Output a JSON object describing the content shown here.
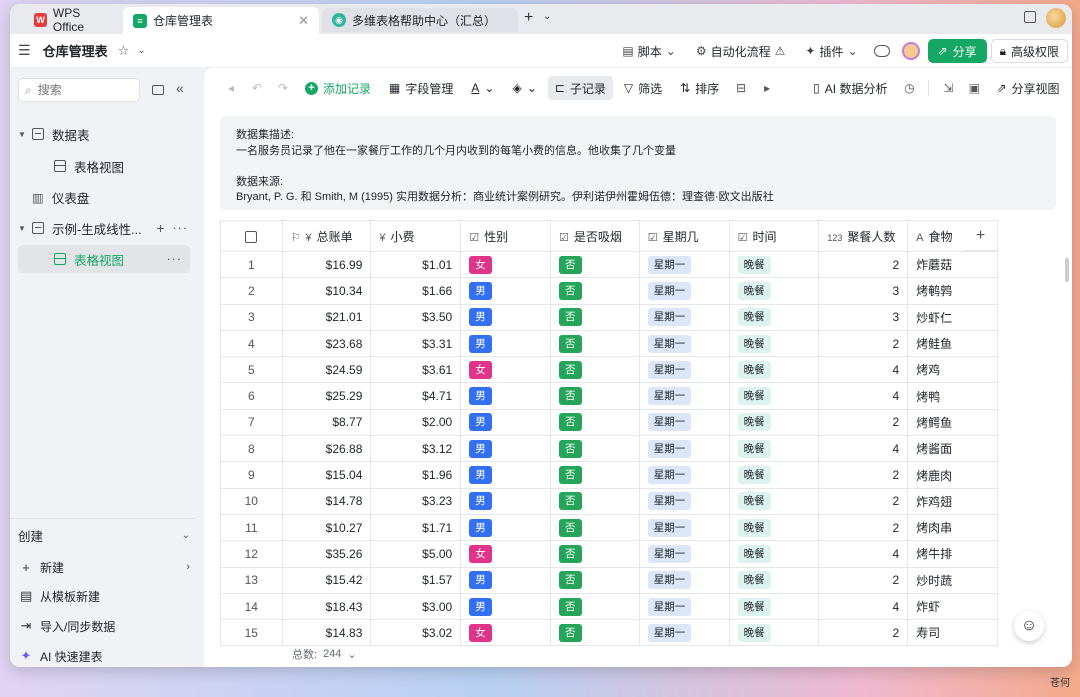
{
  "tabs": [
    {
      "label": "WPS Office"
    },
    {
      "label": "仓库管理表"
    },
    {
      "label": "多维表格帮助中心（汇总）"
    }
  ],
  "header": {
    "title": "仓库管理表",
    "script": "脚本",
    "automation": "自动化流程",
    "plugin": "插件",
    "share": "分享",
    "permission": "高级权限"
  },
  "sidebar": {
    "search_placeholder": "搜索",
    "tree": {
      "datatable": "数据表",
      "table_view": "表格视图",
      "dashboard": "仪表盘",
      "example": "示例-生成线性...",
      "example_view": "表格视图"
    },
    "create": {
      "header": "创建",
      "new": "新建",
      "from_template": "从模板新建",
      "import": "导入/同步数据",
      "ai_build": "AI 快速建表"
    }
  },
  "toolbar": {
    "add_record": "添加记录",
    "field_manage": "字段管理",
    "sub_record": "子记录",
    "filter": "筛选",
    "sort": "排序",
    "ai_analysis": "AI 数据分析",
    "share_view": "分享视图"
  },
  "description": {
    "l1": "数据集描述:",
    "l2": "一名服务员记录了他在一家餐厅工作的几个月内收到的每笔小费的信息。他收集了几个变量",
    "l3": "数据来源:",
    "l4": "Bryant, P. G. 和 Smith, M (1995) 实用数据分析：商业统计案例研究。伊利诺伊州霍姆伍德：理查德·欧文出版社"
  },
  "table": {
    "columns": {
      "total": "总账单",
      "tip": "小费",
      "sex": "性别",
      "smoker": "是否吸烟",
      "day": "星期几",
      "time": "时间",
      "size": "聚餐人数",
      "food": "食物"
    },
    "rows": [
      {
        "n": "1",
        "total": "$16.99",
        "tip": "$1.01",
        "sex": "女",
        "smoker": "否",
        "day": "星期一",
        "time": "晚餐",
        "size": "2",
        "food": "炸蘑菇"
      },
      {
        "n": "2",
        "total": "$10.34",
        "tip": "$1.66",
        "sex": "男",
        "smoker": "否",
        "day": "星期一",
        "time": "晚餐",
        "size": "3",
        "food": "烤鹌鹑"
      },
      {
        "n": "3",
        "total": "$21.01",
        "tip": "$3.50",
        "sex": "男",
        "smoker": "否",
        "day": "星期一",
        "time": "晚餐",
        "size": "3",
        "food": "炒虾仁"
      },
      {
        "n": "4",
        "total": "$23.68",
        "tip": "$3.31",
        "sex": "男",
        "smoker": "否",
        "day": "星期一",
        "time": "晚餐",
        "size": "2",
        "food": "烤鲑鱼"
      },
      {
        "n": "5",
        "total": "$24.59",
        "tip": "$3.61",
        "sex": "女",
        "smoker": "否",
        "day": "星期一",
        "time": "晚餐",
        "size": "4",
        "food": "烤鸡"
      },
      {
        "n": "6",
        "total": "$25.29",
        "tip": "$4.71",
        "sex": "男",
        "smoker": "否",
        "day": "星期一",
        "time": "晚餐",
        "size": "4",
        "food": "烤鸭"
      },
      {
        "n": "7",
        "total": "$8.77",
        "tip": "$2.00",
        "sex": "男",
        "smoker": "否",
        "day": "星期一",
        "time": "晚餐",
        "size": "2",
        "food": "烤鳄鱼"
      },
      {
        "n": "8",
        "total": "$26.88",
        "tip": "$3.12",
        "sex": "男",
        "smoker": "否",
        "day": "星期一",
        "time": "晚餐",
        "size": "4",
        "food": "烤酱面"
      },
      {
        "n": "9",
        "total": "$15.04",
        "tip": "$1.96",
        "sex": "男",
        "smoker": "否",
        "day": "星期一",
        "time": "晚餐",
        "size": "2",
        "food": "烤鹿肉"
      },
      {
        "n": "10",
        "total": "$14.78",
        "tip": "$3.23",
        "sex": "男",
        "smoker": "否",
        "day": "星期一",
        "time": "晚餐",
        "size": "2",
        "food": "炸鸡翅"
      },
      {
        "n": "11",
        "total": "$10.27",
        "tip": "$1.71",
        "sex": "男",
        "smoker": "否",
        "day": "星期一",
        "time": "晚餐",
        "size": "2",
        "food": "烤肉串"
      },
      {
        "n": "12",
        "total": "$35.26",
        "tip": "$5.00",
        "sex": "女",
        "smoker": "否",
        "day": "星期一",
        "time": "晚餐",
        "size": "4",
        "food": "烤牛排"
      },
      {
        "n": "13",
        "total": "$15.42",
        "tip": "$1.57",
        "sex": "男",
        "smoker": "否",
        "day": "星期一",
        "time": "晚餐",
        "size": "2",
        "food": "炒时蔬"
      },
      {
        "n": "14",
        "total": "$18.43",
        "tip": "$3.00",
        "sex": "男",
        "smoker": "否",
        "day": "星期一",
        "time": "晚餐",
        "size": "4",
        "food": "炸虾"
      },
      {
        "n": "15",
        "total": "$14.83",
        "tip": "$3.02",
        "sex": "女",
        "smoker": "否",
        "day": "星期一",
        "time": "晚餐",
        "size": "2",
        "food": "寿司"
      }
    ]
  },
  "footer": {
    "label": "总数:",
    "count": "244"
  },
  "watermark": "苍何"
}
